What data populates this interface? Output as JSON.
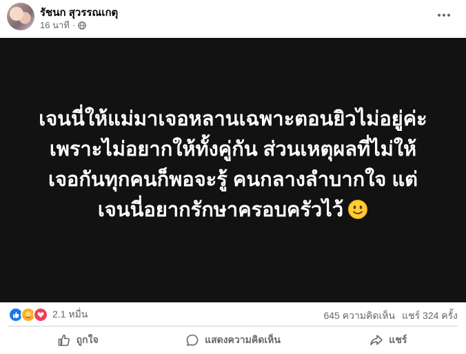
{
  "header": {
    "author_name": "รัชนก สุวรรณเกตุ",
    "timestamp": "16 นาที",
    "separator": "·",
    "privacy_icon": "globe-icon",
    "more_icon": "more-options-icon"
  },
  "post": {
    "background_color": "#121212",
    "lines": [
      "เจนนี่ให้แม่มาเจอหลานเฉพาะตอนยิวไม่อยู่ค่ะ",
      "เพราะไม่อยากให้ทั้งคู่กัน ส่วนเหตุผลที่ไม่ให้",
      "เจอกันทุกคนก็พอจะรู้ คนกลางลำบากใจ แต่",
      "เจนนี่อยากรักษาครอบครัวไว้"
    ],
    "emoji": "slightly-smiling-face-icon"
  },
  "stats": {
    "reactions": [
      "like-reaction-icon",
      "care-reaction-icon",
      "love-reaction-icon"
    ],
    "reaction_count": "2.1 หมื่น",
    "comments": "645 ความคิดเห็น",
    "shares": "แชร์ 324 ครั้ง"
  },
  "actions": {
    "like": "ถูกใจ",
    "comment": "แสดงความคิดเห็น",
    "share": "แชร์"
  },
  "colors": {
    "brand_blue": "#1877f2",
    "secondary_text": "#65676b",
    "love_red": "#f33e58",
    "care_yellow": "#f7b125"
  }
}
